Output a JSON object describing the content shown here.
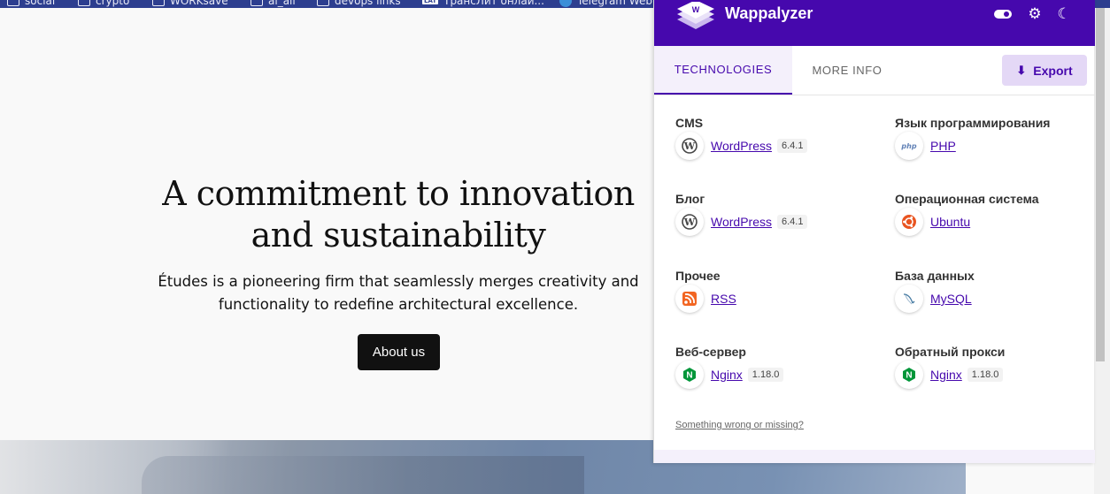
{
  "bookmarks": [
    {
      "label": "social"
    },
    {
      "label": "crypto"
    },
    {
      "label": "WORKsave"
    },
    {
      "label": "ai_all"
    },
    {
      "label": "devops links"
    },
    {
      "label": "ТранcЛит онлай..."
    },
    {
      "label": "Telegram Web"
    }
  ],
  "page": {
    "hero_title_line1": "A commitment to innovation",
    "hero_title_line2": "and sustainability",
    "hero_text_line1": "Études is a pioneering firm that seamlessly merges creativity and",
    "hero_text_line2": "functionality to redefine architectural excellence.",
    "about_button": "About us"
  },
  "wappalyzer": {
    "brand": "Wappalyzer",
    "tabs": {
      "technologies": "TECHNOLOGIES",
      "more_info": "MORE INFO"
    },
    "export_label": "Export",
    "colors": {
      "header": "#4608ad",
      "accent": "#4608ad",
      "export_bg": "#e4d8f6"
    },
    "categories": [
      {
        "title": "CMS",
        "tech": "WordPress",
        "version": "6.4.1",
        "icon": "wordpress-icon"
      },
      {
        "title": "Язык программирования",
        "tech": "PHP",
        "version": "",
        "icon": "php-icon"
      },
      {
        "title": "Блог",
        "tech": "WordPress",
        "version": "6.4.1",
        "icon": "wordpress-icon"
      },
      {
        "title": "Операционная система",
        "tech": "Ubuntu",
        "version": "",
        "icon": "ubuntu-icon"
      },
      {
        "title": "Прочее",
        "tech": "RSS",
        "version": "",
        "icon": "rss-icon"
      },
      {
        "title": "База данных",
        "tech": "MySQL",
        "version": "",
        "icon": "mysql-icon"
      },
      {
        "title": "Веб-сервер",
        "tech": "Nginx",
        "version": "1.18.0",
        "icon": "nginx-icon"
      },
      {
        "title": "Обратный прокси",
        "tech": "Nginx",
        "version": "1.18.0",
        "icon": "nginx-icon"
      }
    ],
    "footer_link": "Something wrong or missing?"
  }
}
